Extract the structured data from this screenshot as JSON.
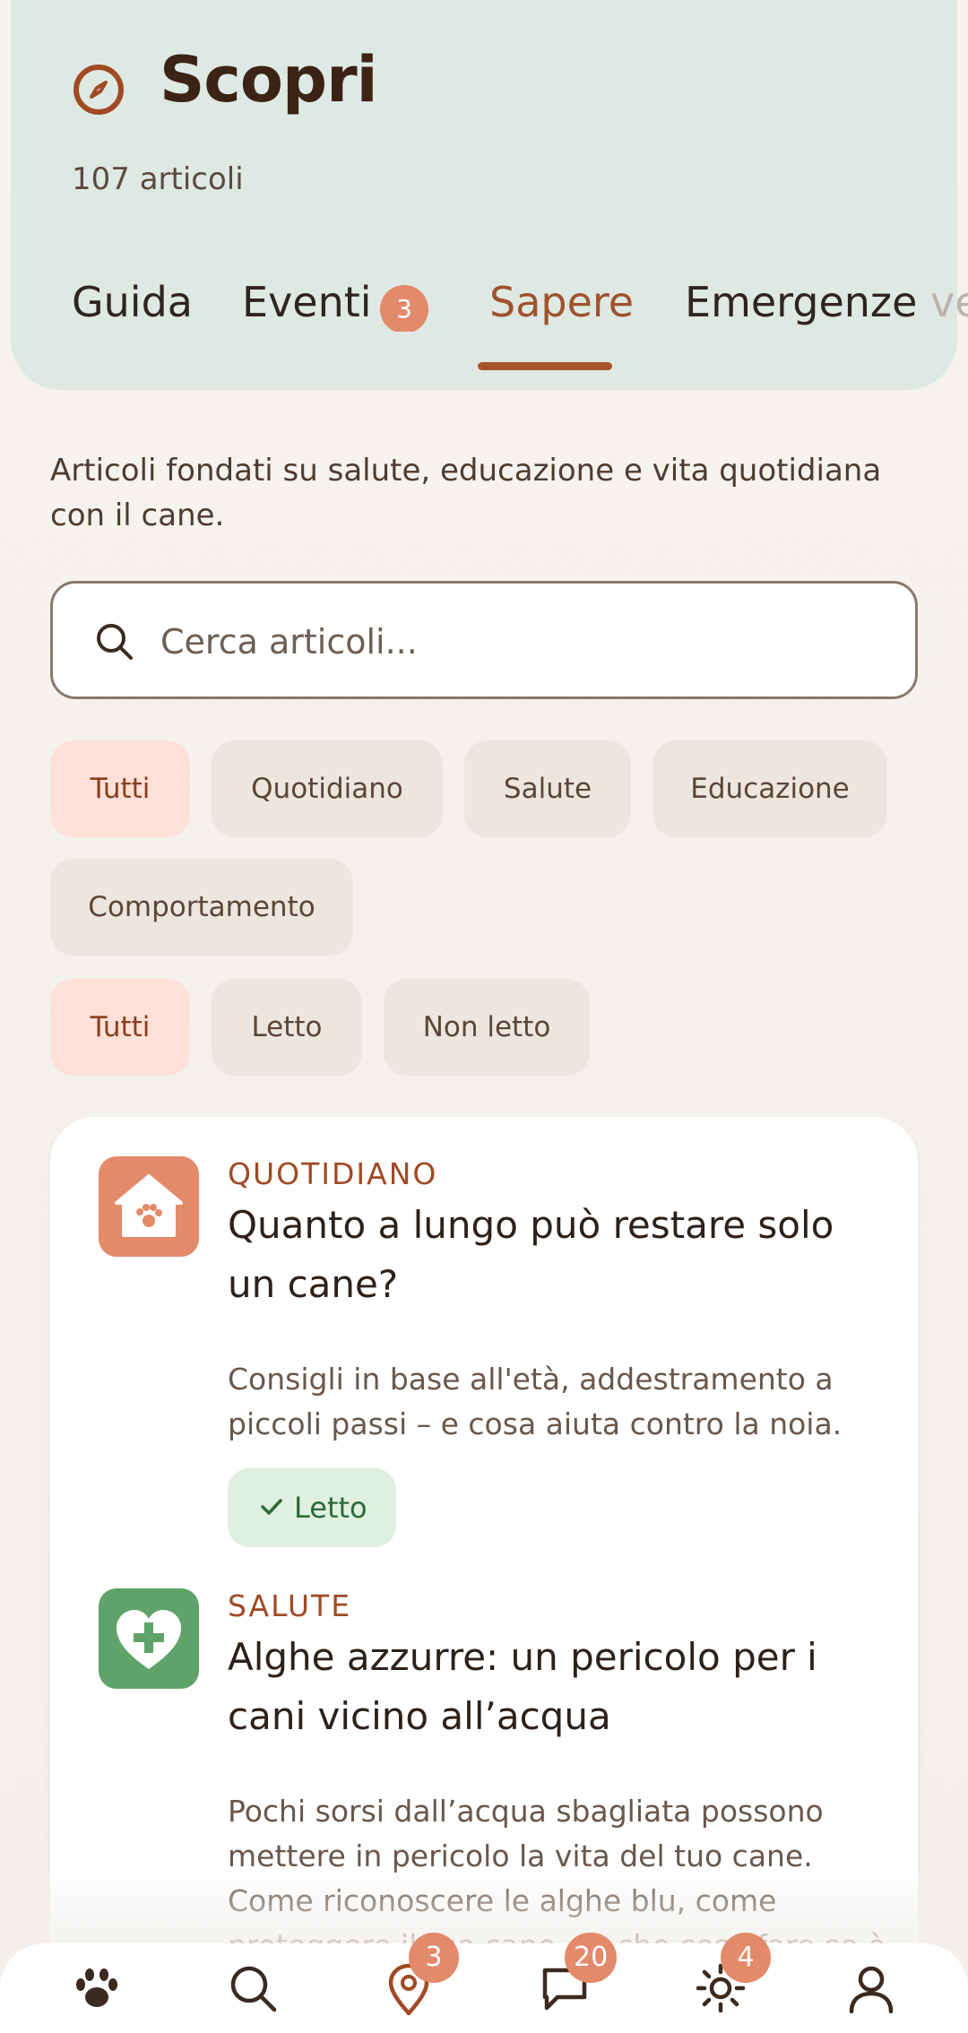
{
  "header": {
    "title": "Scopri",
    "subtitle": "107 articoli",
    "tabs": [
      {
        "label": "Guida"
      },
      {
        "label": "Eventi",
        "badge": "3"
      },
      {
        "label": "Sapere",
        "active": true
      },
      {
        "label": "Emergenze vet"
      }
    ],
    "tab_emerg_main": "Emergenze ",
    "tab_emerg_fade": "vet"
  },
  "intro": "Articoli fondati su salute, educazione e vita quotidiana con il cane.",
  "search": {
    "placeholder": "Cerca articoli..."
  },
  "filters": {
    "category": [
      "Tutti",
      "Quotidiano",
      "Salute",
      "Educazione",
      "Comportamento"
    ],
    "read_state": [
      "Tutti",
      "Letto",
      "Non letto"
    ],
    "active_category": "Tutti",
    "active_read_state": "Tutti"
  },
  "articles": [
    {
      "category": "QUOTIDIANO",
      "icon": "home-paw-icon",
      "title": "Quanto a lungo può restare solo un cane?",
      "description": "Consigli in base all'età, addestramento a piccoli passi – e cosa aiuta contro la noia.",
      "status": "Letto"
    },
    {
      "category": "SALUTE",
      "icon": "heart-cross-icon",
      "title": "Alghe azzurre: un pericolo per i cani vicino all’acqua",
      "description": "Pochi sorsi dall’acqua sbagliata possono mettere in pericolo la vita del tuo cane. Come riconoscere le alghe blu, come proteggere il tuo cane – e che cosa fare se è stato in"
    }
  ],
  "nav": [
    {
      "icon": "paw-icon"
    },
    {
      "icon": "search-icon"
    },
    {
      "icon": "map-pin-icon",
      "badge": "3"
    },
    {
      "icon": "chat-icon",
      "badge": "20"
    },
    {
      "icon": "sun-icon",
      "badge": "4"
    },
    {
      "icon": "profile-icon"
    }
  ],
  "colors": {
    "accent": "#a0522d",
    "badge": "#e38a6a",
    "header_bg": "#dfe9e4",
    "chip_active_bg": "#fde0d7",
    "read_pill_bg": "#dff0e1",
    "quotidiano_icon_bg": "#e38a6a",
    "salute_icon_bg": "#5fa36a"
  }
}
